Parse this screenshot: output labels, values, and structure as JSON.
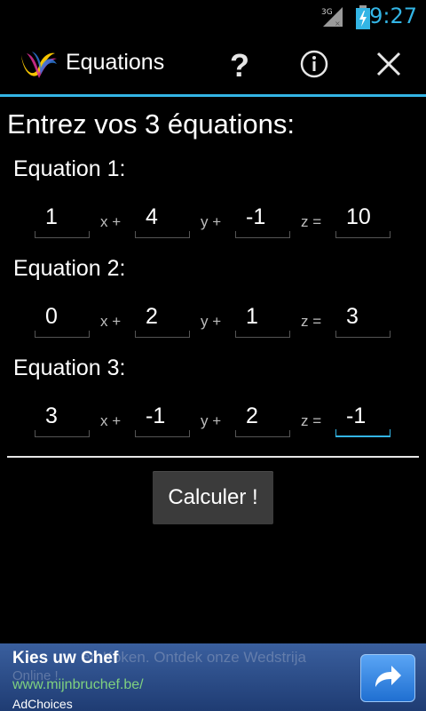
{
  "status": {
    "network": "3G",
    "time": "9:27"
  },
  "actionbar": {
    "title": "Equations",
    "help_icon": "?",
    "info_icon": "info-icon",
    "close_icon": "close-icon",
    "accent": "#33b5e5"
  },
  "prompt": "Entrez vos 3 équations:",
  "variables": {
    "x": "x +",
    "y": "y +",
    "z": "z ="
  },
  "equations": [
    {
      "label": "Equation 1:",
      "a": "1",
      "b": "4",
      "c": "-1",
      "d": "10"
    },
    {
      "label": "Equation 2:",
      "a": "0",
      "b": "2",
      "c": "1",
      "d": "3"
    },
    {
      "label": "Equation 3:",
      "a": "3",
      "b": "-1",
      "c": "2",
      "d": "-1"
    }
  ],
  "calculate_label": "Calculer !",
  "ad": {
    "title": "Kies uw Chef",
    "background_text_line1": "en Koken. Ontdek onze Wedstrija",
    "background_text_line2": "Online !",
    "url": "www.mijnbruchef.be/",
    "choices": "AdChoices"
  }
}
